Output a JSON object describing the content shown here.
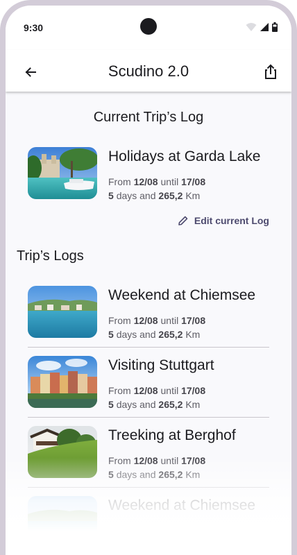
{
  "status": {
    "time": "9:30"
  },
  "appbar": {
    "title": "Scudino 2.0"
  },
  "icons": {
    "back": "arrow-left-icon",
    "share": "share-icon",
    "edit": "pencil-icon"
  },
  "current": {
    "heading": "Current Trip’s Log",
    "trip": {
      "title": "Holidays at Garda Lake",
      "from_label": "From",
      "from": "12/08",
      "until_label": "until",
      "until": "17/08",
      "days": "5",
      "days_label": "days and",
      "km": "265,2",
      "km_label": "Km"
    },
    "edit_label": "Edit current Log"
  },
  "logs": {
    "heading": "Trip’s Logs",
    "items": [
      {
        "title": "Weekend at Chiemsee",
        "from_label": "From",
        "from": "12/08",
        "until_label": "until",
        "until": "17/08",
        "days": "5",
        "days_label": "days and",
        "km": "265,2",
        "km_label": "Km"
      },
      {
        "title": "Visiting Stuttgart",
        "from_label": "From",
        "from": "12/08",
        "until_label": "until",
        "until": "17/08",
        "days": "5",
        "days_label": "days and",
        "km": "265,2",
        "km_label": "Km"
      },
      {
        "title": "Treeking at Berghof",
        "from_label": "From",
        "from": "12/08",
        "until_label": "until",
        "until": "17/08",
        "days": "5",
        "days_label": "days and",
        "km": "265,2",
        "km_label": "Km"
      },
      {
        "title": "Weekend at Chiemsee"
      }
    ]
  },
  "colors": {
    "accent": "#4d4a6e",
    "frame": "#d3ccd8",
    "background": "#f9f9fc"
  }
}
